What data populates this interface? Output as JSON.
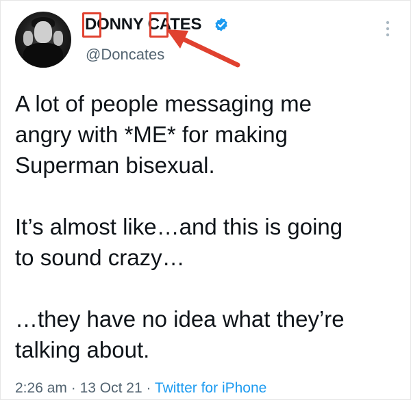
{
  "tweet": {
    "display_name": "DONNY CATES",
    "handle": "@Doncates",
    "paragraphs": [
      "A lot of people messaging me\nangry with *ME* for making\nSuperman bisexual.",
      "It’s almost like…and this is going\nto sound crazy…",
      "…they have no idea what they’re\ntalking about."
    ],
    "time": "2:26 am",
    "separator": " · ",
    "date": "13 Oct 21",
    "source": "Twitter for iPhone",
    "verified": true
  },
  "icons": {
    "verified": "verified-badge-icon",
    "more": "more-vertical-icon"
  },
  "colors": {
    "text": "#0f1419",
    "secondary": "#536471",
    "link": "#1d9bf0",
    "verified": "#1d9bf0",
    "annotation": "#e0412f"
  }
}
